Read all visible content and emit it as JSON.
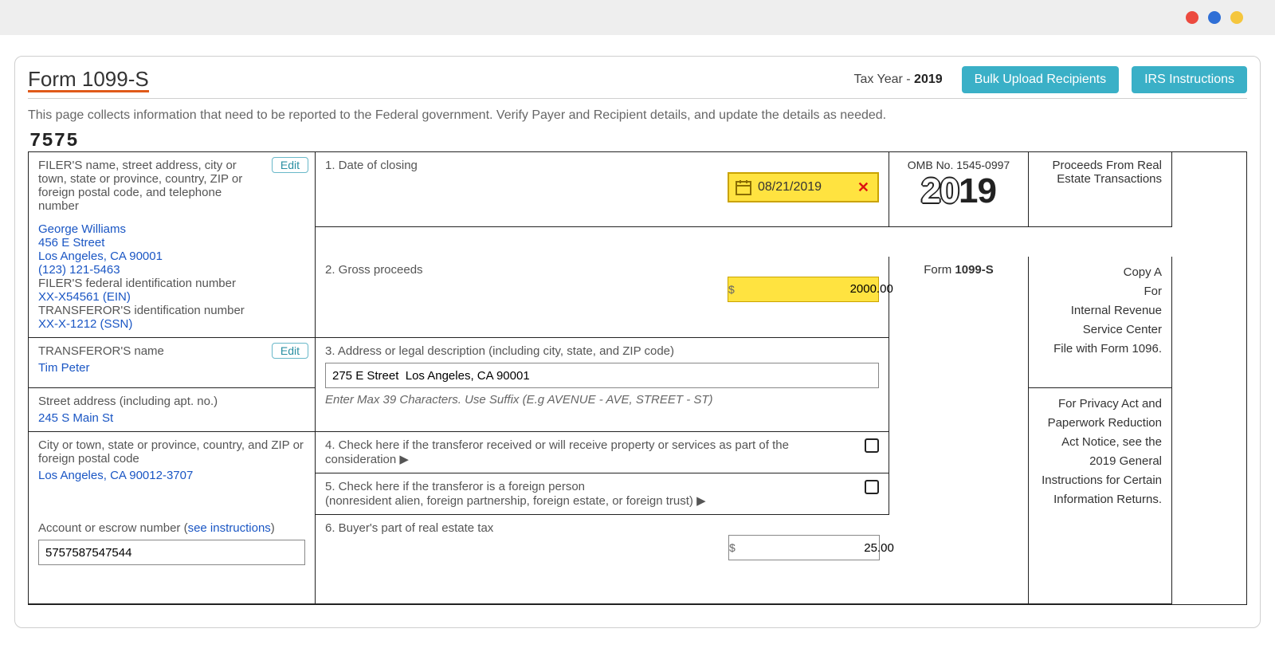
{
  "header": {
    "title": "Form 1099-S",
    "tax_year_label": "Tax Year - ",
    "tax_year": "2019",
    "btn_bulk": "Bulk Upload Recipients",
    "btn_irs": "IRS Instructions"
  },
  "description": "This page collects information that need to be reported to the Federal government. Verify Payer and Recipient details, and update the details as needed.",
  "form_code": "7575",
  "filer_block": {
    "label": "FILER'S name, street address, city or town, state or province, country, ZIP or foreign postal code, and telephone number",
    "edit": "Edit",
    "name": "George Williams",
    "addr1": "456 E Street",
    "addr2": "Los Angeles, CA 90001",
    "phone": "(123) 121-5463",
    "fein_label": "FILER'S federal identification number",
    "fein": "XX-X54561 (EIN)",
    "tin_label": "TRANSFEROR'S identification number",
    "tin": "XX-X-1212 (SSN)"
  },
  "transferor": {
    "name_label": "TRANSFEROR'S name",
    "edit": "Edit",
    "name": "Tim Peter",
    "street_label": "Street address (including apt. no.)",
    "street": "245 S Main St",
    "city_label": "City or town, state or province, country, and ZIP or foreign postal code",
    "city": "Los Angeles, CA 90012-3707",
    "account_label_pre": "Account or escrow number (",
    "account_link": "see instructions",
    "account_label_post": ")",
    "account": "5757587547544"
  },
  "boxes": {
    "b1_label": "1. Date of closing",
    "b1_value": "08/21/2019",
    "b2_label": "2. Gross proceeds",
    "b2_value": "2000.00",
    "b3_label": "3. Address or legal description (including city, state, and ZIP code)",
    "b3_value": "275 E Street  Los Angeles, CA 90001",
    "b3_hint": "Enter Max 39 Characters. Use Suffix (E.g AVENUE - AVE, STREET - ST)",
    "b4_label": "4. Check here if the transferor received or will receive property or services as part of the consideration ▶",
    "b5_label1": "5. Check here if the transferor is a foreign person",
    "b5_label2": "(nonresident alien, foreign partnership, foreign estate, or foreign trust) ▶",
    "b6_label": "6. Buyer's part of real estate tax",
    "b6_value": "25.00"
  },
  "right": {
    "omb": "OMB No. 1545-0997",
    "year_outline": "20",
    "year_solid": "19",
    "form_name": "Form 1099-S",
    "title1": "Proceeds From Real",
    "title2": "Estate Transactions",
    "copy_a": "Copy A",
    "for": "For",
    "irs1": "Internal Revenue",
    "irs2": "Service Center",
    "file_with": "File with Form 1096.",
    "privacy": "For Privacy Act and Paperwork Reduction Act Notice, see the 2019 General Instructions for Certain Information Returns."
  }
}
